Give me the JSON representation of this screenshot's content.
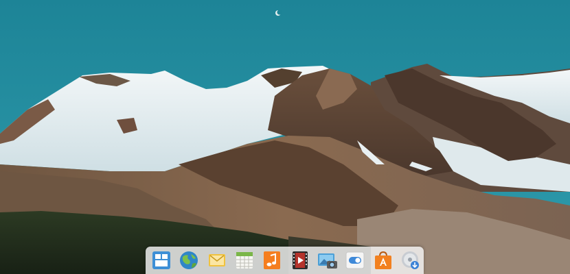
{
  "desktop": {
    "wallpaper": "mountain-landscape"
  },
  "dock": {
    "items": [
      {
        "name": "multitasking-view",
        "icon": "multitasking-view-icon",
        "color": "#3d8fd6"
      },
      {
        "name": "web-browser",
        "icon": "globe-icon",
        "color": "#2f86c7"
      },
      {
        "name": "mail",
        "icon": "envelope-icon",
        "color": "#f0c23d"
      },
      {
        "name": "calendar",
        "icon": "calendar-icon",
        "color": "#7ab648"
      },
      {
        "name": "music",
        "icon": "music-note-icon",
        "color": "#f57e1f"
      },
      {
        "name": "videos",
        "icon": "film-play-icon",
        "color": "#b5332b"
      },
      {
        "name": "photos",
        "icon": "photos-camera-icon",
        "color": "#4b9fd6"
      },
      {
        "name": "system-settings",
        "icon": "toggle-switch-icon",
        "color": "#3f89d8"
      },
      {
        "name": "app-center",
        "icon": "shopping-bag-icon",
        "color": "#f2801f"
      },
      {
        "name": "disk-installer",
        "icon": "disc-download-icon",
        "color": "#c8ccd2"
      }
    ]
  }
}
